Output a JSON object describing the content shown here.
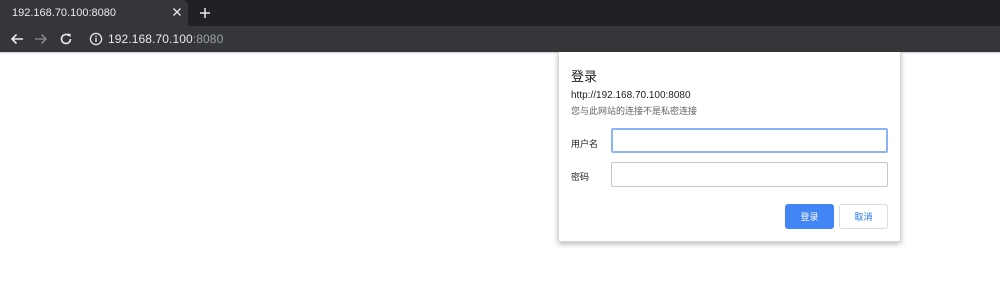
{
  "browser": {
    "tab": {
      "title": "192.168.70.100:8080",
      "close_icon": "close-icon"
    },
    "new_tab_icon": "plus-icon",
    "nav": {
      "back_icon": "arrow-left-icon",
      "forward_icon": "arrow-right-icon",
      "reload_icon": "reload-icon"
    },
    "omnibox": {
      "security_icon": "info-icon",
      "url_host": "192.168.70.100",
      "url_port": ":8080"
    },
    "colors": {
      "tabstrip": "#202124",
      "toolbar": "#35363a",
      "text": "#e8eaed",
      "muted": "#9aa0a6"
    }
  },
  "dialog": {
    "title": "登录",
    "origin": "http://192.168.70.100:8080",
    "warning": "您与此网站的连接不是私密连接",
    "username_label": "用户名",
    "username_value": "",
    "password_label": "密码",
    "password_value": "",
    "login_button": "登录",
    "cancel_button": "取消",
    "colors": {
      "primary": "#4285f4",
      "focus_border": "#8ab4f8"
    }
  }
}
